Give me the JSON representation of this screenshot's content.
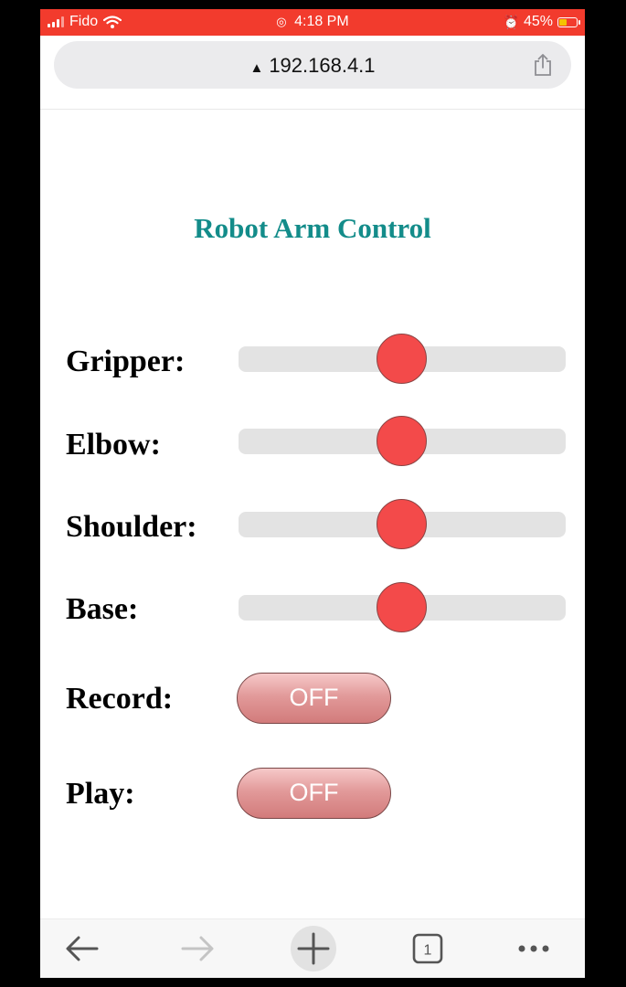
{
  "status_bar": {
    "carrier": "Fido",
    "time": "4:18 PM",
    "battery_text": "45%",
    "battery_level": 0.45
  },
  "browser": {
    "url": "192.168.4.1",
    "tab_count": "1"
  },
  "page": {
    "title": "Robot Arm Control",
    "sliders": [
      {
        "label": "Gripper:",
        "value": 0.5
      },
      {
        "label": "Elbow:",
        "value": 0.5
      },
      {
        "label": "Shoulder:",
        "value": 0.5
      },
      {
        "label": "Base:",
        "value": 0.5
      }
    ],
    "toggles": [
      {
        "label": "Record:",
        "state": "OFF"
      },
      {
        "label": "Play:",
        "state": "OFF"
      }
    ]
  },
  "icons": [
    "signal-icon",
    "wifi-icon",
    "alarm-icon",
    "battery-icon",
    "warning-icon",
    "share-icon",
    "back-icon",
    "forward-icon",
    "new-tab-icon",
    "tabs-icon",
    "more-icon"
  ],
  "colors": {
    "status_bar": "#f23b2d",
    "title": "#138c8a",
    "slider_thumb": "#f34a4a",
    "toggle": "#e29a9a"
  }
}
